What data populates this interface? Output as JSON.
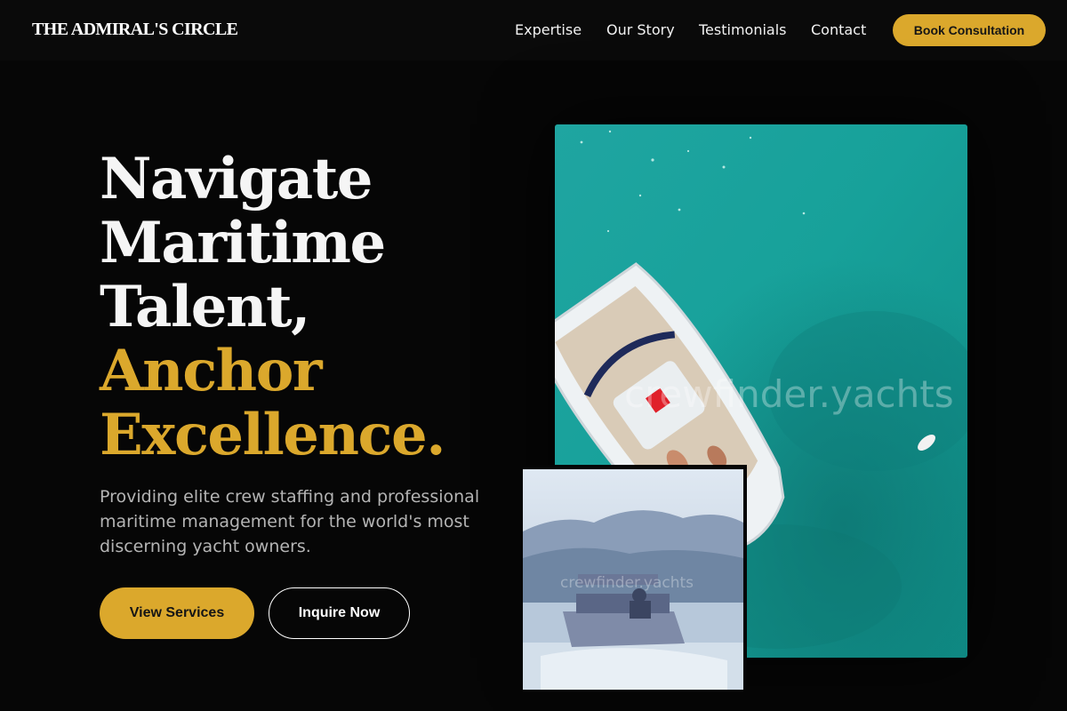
{
  "header": {
    "brand": "THE ADMIRAL'S CIRCLE",
    "nav": [
      {
        "label": "Expertise"
      },
      {
        "label": "Our Story"
      },
      {
        "label": "Testimonials"
      },
      {
        "label": "Contact"
      }
    ],
    "cta_label": "Book Consultation"
  },
  "hero": {
    "headline_lines": [
      "Navigate",
      "Maritime",
      "Talent,"
    ],
    "headline_accent_lines": [
      "Anchor",
      "Excellence."
    ],
    "subcopy": "Providing elite crew staffing and professional maritime management for the world's most discerning yacht owners.",
    "primary_button": "View Services",
    "secondary_button": "Inquire Now"
  },
  "images": {
    "main_watermark": "crewfinder.yachts",
    "inset_watermark": "crewfinder.yachts"
  },
  "colors": {
    "background": "#060606",
    "accent_gold": "#dba82c",
    "text_white": "#f5f5f5",
    "text_muted": "#b4b4b4"
  }
}
